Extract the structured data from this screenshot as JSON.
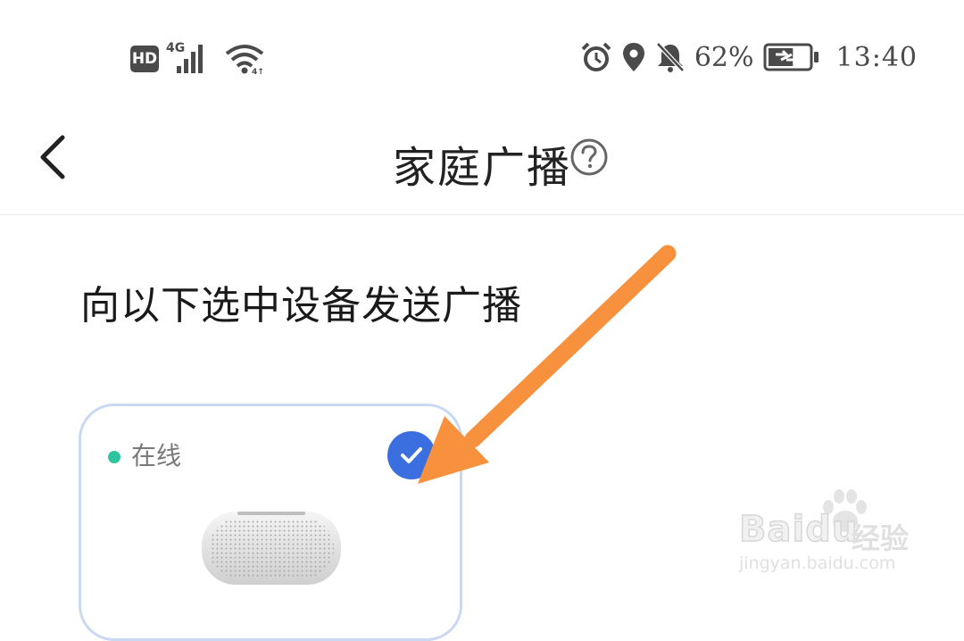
{
  "status_bar": {
    "hd_badge": "HD",
    "network_type": "4G",
    "battery_percent": "62%",
    "battery_level": 0.62,
    "time": "13:40",
    "icons": [
      "signal-icon",
      "wifi-icon",
      "alarm-icon",
      "location-icon",
      "mute-bell-icon",
      "battery-charging-icon"
    ]
  },
  "header": {
    "title": "家庭广播",
    "back_icon": "chevron-left-icon",
    "help_icon": "question-circle-icon"
  },
  "content": {
    "instruction": "向以下选中设备发送广播",
    "devices": [
      {
        "status": "在线",
        "status_color": "#2ec4a0",
        "selected": true,
        "check_color": "#3b6fe0",
        "image": "speaker-device-image"
      }
    ]
  },
  "annotation": {
    "arrow_color": "#f7913d"
  },
  "watermark": {
    "brand": "Baidu",
    "chinese": "经验",
    "url": "jingyan.baidu.com"
  },
  "colors": {
    "card_border": "#c9d9f3",
    "divider": "#e6e6e6"
  }
}
